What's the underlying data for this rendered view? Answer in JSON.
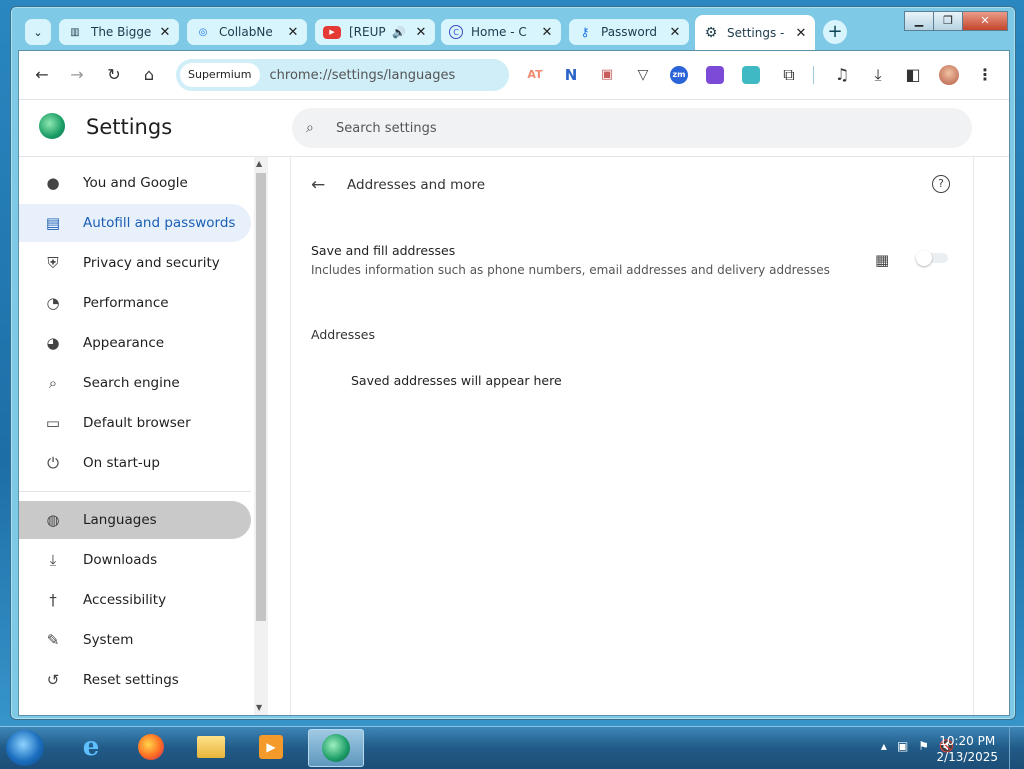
{
  "browser": {
    "tabs": [
      {
        "title": "The Bigge",
        "icon": "museum-icon",
        "icon_glyph": "▥",
        "icon_color": "#222222"
      },
      {
        "title": "CollabNe",
        "icon": "search-icon",
        "icon_glyph": "🔍",
        "icon_color": "#1a73e8"
      },
      {
        "title": "[REUP",
        "icon": "youtube-icon",
        "icon_glyph": "▶",
        "icon_color": "#e53935"
      },
      {
        "title": "Home - C",
        "icon": "circle-c-icon",
        "icon_glyph": "C",
        "icon_color": "#3c4bc9"
      },
      {
        "title": "Password",
        "icon": "key-icon",
        "icon_glyph": "⚿",
        "icon_color": "#1a73e8"
      },
      {
        "title": "Settings -",
        "icon": "gear-icon",
        "icon_glyph": "⚙",
        "icon_color": "#333333"
      }
    ],
    "new_tab_glyph": "+",
    "omnibox": {
      "chip": "Supermium",
      "url": "chrome://settings/languages"
    },
    "extensions": [
      {
        "name": "at-extension-icon",
        "label": "AT",
        "color": "#f4a08a"
      },
      {
        "name": "n-extension-icon",
        "label": "N",
        "color": "#2c64c7"
      },
      {
        "name": "image-extension-icon",
        "label": "▣",
        "color": "#c85b5b"
      },
      {
        "name": "shield-extension-icon",
        "label": "▽",
        "color": "#ffffff"
      },
      {
        "name": "zm-extension-icon",
        "label": "zm",
        "color": "#2b63d8"
      },
      {
        "name": "purple-extension-icon",
        "label": "■",
        "color": "#7b4bd8"
      },
      {
        "name": "teal-extension-icon",
        "label": "◘",
        "color": "#3fb9c4"
      }
    ]
  },
  "settings": {
    "title": "Settings",
    "search_placeholder": "Search settings",
    "nav": [
      {
        "label": "You and Google",
        "icon": "person-icon",
        "glyph": "👤"
      },
      {
        "label": "Autofill and passwords",
        "icon": "clipboard-icon",
        "glyph": "▤"
      },
      {
        "label": "Privacy and security",
        "icon": "shield-icon",
        "glyph": "⛨"
      },
      {
        "label": "Performance",
        "icon": "speedometer-icon",
        "glyph": "◔"
      },
      {
        "label": "Appearance",
        "icon": "palette-icon",
        "glyph": "🎨"
      },
      {
        "label": "Search engine",
        "icon": "search-icon",
        "glyph": "🔍"
      },
      {
        "label": "Default browser",
        "icon": "browser-icon",
        "glyph": "▭"
      },
      {
        "label": "On start-up",
        "icon": "power-icon",
        "glyph": "⏻"
      },
      {
        "label": "Languages",
        "icon": "globe-icon",
        "glyph": "🌐"
      },
      {
        "label": "Downloads",
        "icon": "download-icon",
        "glyph": "⤓"
      },
      {
        "label": "Accessibility",
        "icon": "accessibility-icon",
        "glyph": "♿"
      },
      {
        "label": "System",
        "icon": "wrench-icon",
        "glyph": "🔧"
      },
      {
        "label": "Reset settings",
        "icon": "history-icon",
        "glyph": "↺"
      }
    ],
    "page": {
      "title": "Addresses and more",
      "save_label": "Save and fill addresses",
      "save_desc": "Includes information such as phone numbers, email addresses and delivery addresses",
      "toggle_on": false,
      "section_title": "Addresses",
      "empty_text": "Saved addresses will appear here"
    }
  },
  "taskbar": {
    "time": "10:20 PM",
    "date": "2/13/2025"
  }
}
